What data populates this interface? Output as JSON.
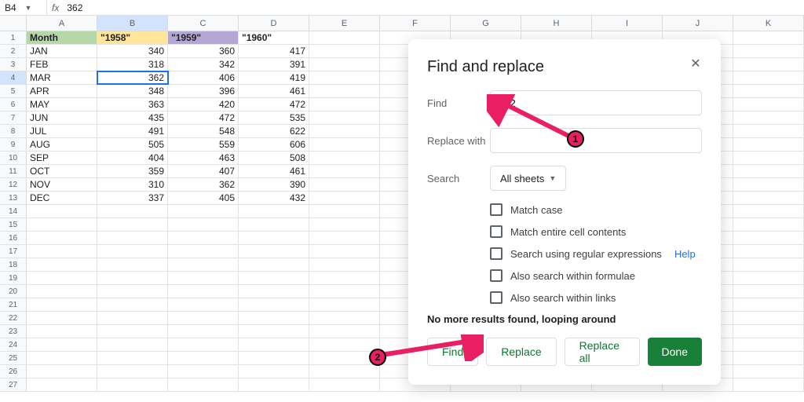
{
  "formula_bar": {
    "name_box": "B4",
    "value": "362"
  },
  "columns": [
    "A",
    "B",
    "C",
    "D",
    "E",
    "F",
    "G",
    "H",
    "I",
    "J",
    "K"
  ],
  "header_row": {
    "month": "Month",
    "y1958": "\"1958\"",
    "y1959": "\"1959\"",
    "y1960": "\"1960\""
  },
  "data_rows": [
    {
      "m": "JAN",
      "a": 340,
      "b": 360,
      "c": 417
    },
    {
      "m": "FEB",
      "a": 318,
      "b": 342,
      "c": 391
    },
    {
      "m": "MAR",
      "a": 362,
      "b": 406,
      "c": 419
    },
    {
      "m": "APR",
      "a": 348,
      "b": 396,
      "c": 461
    },
    {
      "m": "MAY",
      "a": 363,
      "b": 420,
      "c": 472
    },
    {
      "m": "JUN",
      "a": 435,
      "b": 472,
      "c": 535
    },
    {
      "m": "JUL",
      "a": 491,
      "b": 548,
      "c": 622
    },
    {
      "m": "AUG",
      "a": 505,
      "b": 559,
      "c": 606
    },
    {
      "m": "SEP",
      "a": 404,
      "b": 463,
      "c": 508
    },
    {
      "m": "OCT",
      "a": 359,
      "b": 407,
      "c": 461
    },
    {
      "m": "NOV",
      "a": 310,
      "b": 362,
      "c": 390
    },
    {
      "m": "DEC",
      "a": 337,
      "b": 405,
      "c": 432
    }
  ],
  "selected_cell": {
    "row": 4,
    "col": "B"
  },
  "empty_rows": [
    14,
    15,
    16,
    17,
    18,
    19,
    20,
    21,
    22,
    23,
    24,
    25,
    26,
    27
  ],
  "dialog": {
    "title": "Find and replace",
    "find_label": "Find",
    "find_value": "362",
    "replace_label": "Replace with",
    "replace_value": "",
    "search_label": "Search",
    "search_scope": "All sheets",
    "chk_match_case": "Match case",
    "chk_match_whole": "Match entire cell contents",
    "chk_regex": "Search using regular expressions",
    "help": "Help",
    "chk_formulae": "Also search within formulae",
    "chk_links": "Also search within links",
    "status": "No more results found, looping around",
    "btn_find": "Find",
    "btn_replace": "Replace",
    "btn_replace_all": "Replace all",
    "btn_done": "Done"
  },
  "annotations": {
    "m1": "1",
    "m2": "2"
  }
}
